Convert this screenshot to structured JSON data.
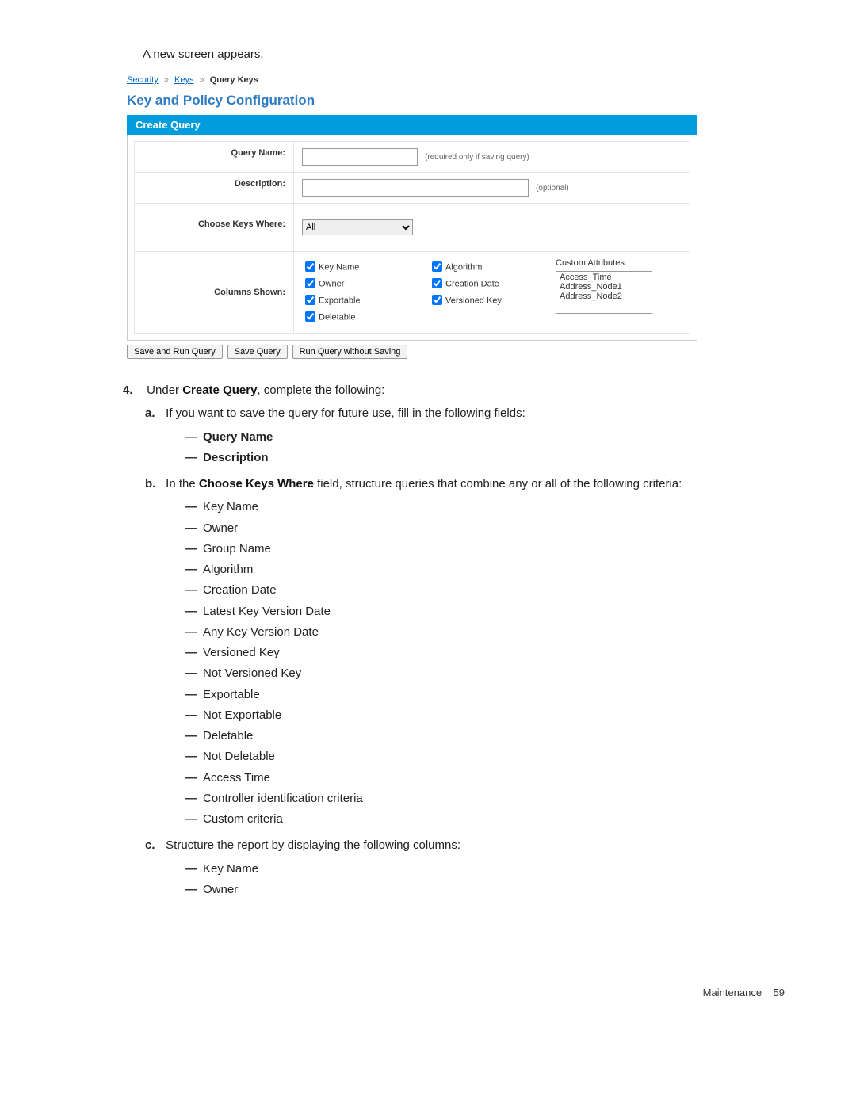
{
  "intro": "A new screen appears.",
  "breadcrumb": {
    "l1": "Security",
    "l2": "Keys",
    "l3": "Query Keys"
  },
  "screenshot": {
    "page_title": "Key and Policy Configuration",
    "panel_title": "Create Query",
    "rows": {
      "query_name_label": "Query Name:",
      "query_name_hint": "(required only if saving query)",
      "description_label": "Description:",
      "description_hint": "(optional)",
      "choose_label": "Choose Keys Where:",
      "choose_value": "All",
      "columns_label": "Columns Shown:"
    },
    "columns_col1": [
      "Key Name",
      "Owner",
      "Exportable",
      "Deletable"
    ],
    "columns_col2": [
      "Algorithm",
      "Creation Date",
      "Versioned Key"
    ],
    "custom_attr_label": "Custom Attributes:",
    "custom_attrs": [
      "Access_Time",
      "Address_Node1",
      "Address_Node2"
    ],
    "buttons": {
      "save_run": "Save and Run Query",
      "save": "Save Query",
      "run_without": "Run Query without Saving"
    }
  },
  "step4": {
    "num": "4.",
    "text_pre": "Under ",
    "text_bold": "Create Query",
    "text_post": ", complete the following:",
    "a": {
      "let": "a.",
      "text": "If you want to save the query for future use, fill in the following fields:",
      "items": [
        "Query Name",
        "Description"
      ]
    },
    "b": {
      "let": "b.",
      "pre": "In the ",
      "bold": "Choose Keys Where",
      "post": " field, structure queries that combine any or all of the following criteria:",
      "items": [
        "Key Name",
        "Owner",
        "Group Name",
        "Algorithm",
        "Creation Date",
        "Latest Key Version Date",
        "Any Key Version Date",
        "Versioned Key",
        "Not Versioned Key",
        "Exportable",
        "Not Exportable",
        "Deletable",
        "Not Deletable",
        "Access Time",
        "Controller identification criteria",
        "Custom criteria"
      ]
    },
    "c": {
      "let": "c.",
      "text": "Structure the report by displaying the following columns:",
      "items": [
        "Key Name",
        "Owner"
      ]
    }
  },
  "footer": {
    "section": "Maintenance",
    "page": "59"
  }
}
